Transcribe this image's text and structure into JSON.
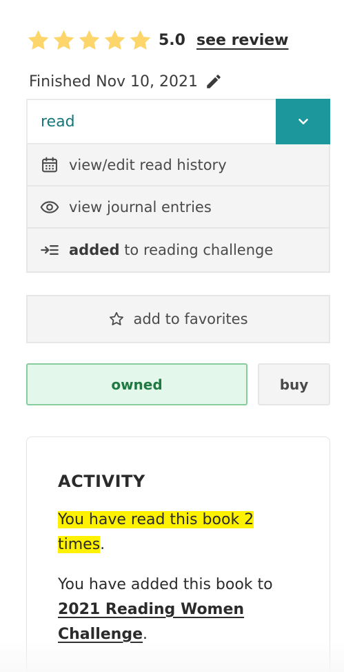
{
  "rating": {
    "stars_filled": 5,
    "stars_total": 5,
    "value_text": "5.0",
    "see_review_label": "see review",
    "star_color": "#fcd56b"
  },
  "finished": {
    "label": "Finished Nov 10, 2021"
  },
  "status": {
    "selected": "read",
    "accent_color": "#1c979b",
    "toggle_icon": "chevron-down-icon"
  },
  "menu": {
    "items": [
      {
        "icon": "calendar-icon",
        "label": "view/edit read history"
      },
      {
        "icon": "eye-icon",
        "label": "view journal entries"
      },
      {
        "icon": "list-indent-icon",
        "label_bold": "added",
        "label_rest": " to reading challenge"
      }
    ]
  },
  "favorites": {
    "icon": "star-outline-icon",
    "label": "add to favorites"
  },
  "ownership": {
    "owned_label": "owned",
    "buy_label": "buy"
  },
  "activity": {
    "title": "ACTIVITY",
    "read_count_highlight": "You have read this book 2 times",
    "read_count_suffix": ".",
    "added_prefix": "You have added this book to ",
    "challenge_name": "2021 Reading Women Challenge",
    "added_suffix": ".",
    "highlight_color": "#fff200"
  }
}
